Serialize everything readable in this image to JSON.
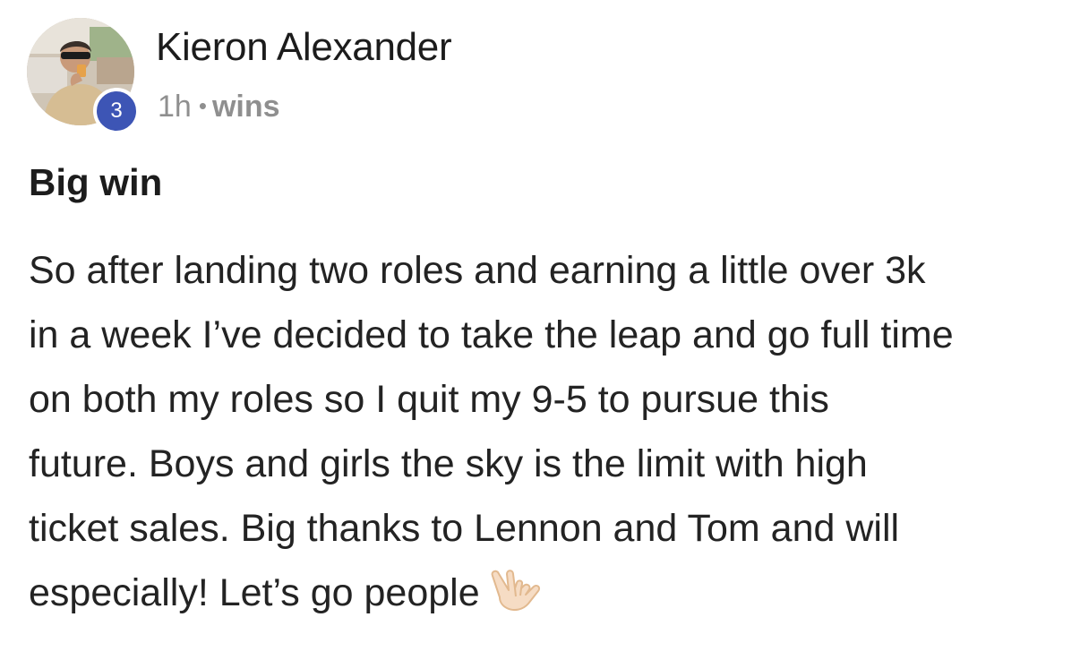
{
  "author": {
    "name": "Kieron Alexander",
    "level": "3"
  },
  "meta": {
    "time": "1h",
    "separator": "•",
    "category": "wins"
  },
  "post": {
    "title": "Big win",
    "body_lines": [
      "So after landing two roles and earning a little over 3k",
      "in a week I’ve decided to take the leap and go full time",
      "on both my roles so I quit my 9-5 to pursue this",
      "future. Boys and girls the sky is the limit with high",
      "ticket sales. Big thanks to Lennon and Tom and will",
      "especially! Let’s go people"
    ],
    "emoji": "love-you-gesture-icon"
  },
  "colors": {
    "badge": "#3d55b5",
    "meta_text": "#8f8f8f",
    "text": "#232323"
  }
}
